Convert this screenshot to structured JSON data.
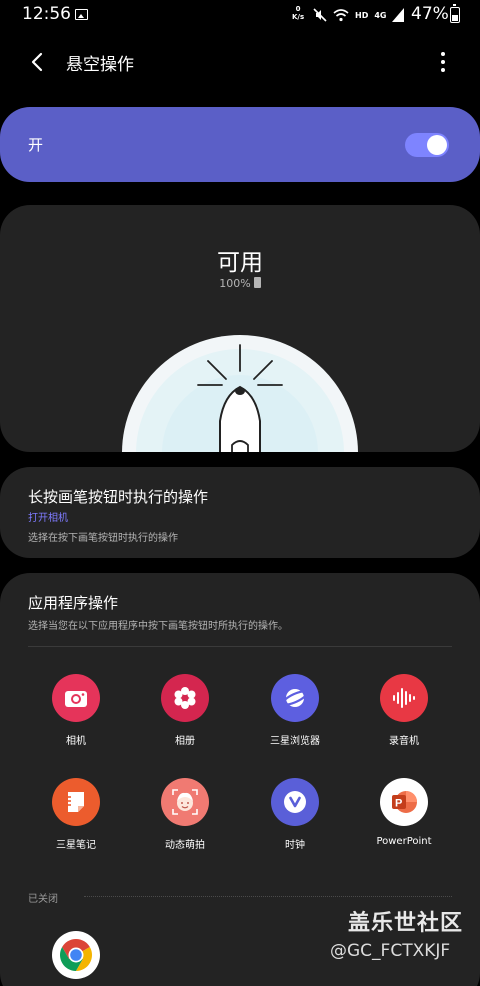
{
  "status_bar": {
    "time": "12:56",
    "net_speed_value": "0",
    "net_speed_unit": "K/s",
    "hd_label": "HD",
    "network_label": "4G",
    "battery_percent": "47%",
    "icons": [
      "image-icon",
      "mute-icon",
      "wifi-icon",
      "signal-icon",
      "battery-icon"
    ]
  },
  "app_bar": {
    "title": "悬空操作",
    "back_icon": "back-arrow-icon",
    "more_icon": "more-vert-icon"
  },
  "master_switch": {
    "label": "开",
    "state": true,
    "accent_color": "#5b5fc7"
  },
  "pen": {
    "status": "可用",
    "battery": "100%"
  },
  "long_press": {
    "title": "长按画笔按钮时执行的操作",
    "value": "打开相机",
    "description": "选择在按下画笔按钮时执行的操作"
  },
  "app_actions": {
    "title": "应用程序操作",
    "description": "选择当您在以下应用程序中按下画笔按钮时所执行的操作。",
    "apps": [
      {
        "label": "相机",
        "icon": "camera-icon",
        "color": "#e5345a"
      },
      {
        "label": "相册",
        "icon": "gallery-flower-icon",
        "color": "#d4264f"
      },
      {
        "label": "三星浏览器",
        "icon": "browser-planet-icon",
        "color": "#5d5fe0"
      },
      {
        "label": "录音机",
        "icon": "voice-recorder-icon",
        "color": "#e83844"
      },
      {
        "label": "三星笔记",
        "icon": "notes-icon",
        "color": "#ec5c2d"
      },
      {
        "label": "动态萌拍",
        "icon": "ar-emoji-icon",
        "color": "#f07a72"
      },
      {
        "label": "时钟",
        "icon": "clock-icon",
        "color": "#5a5fd8"
      },
      {
        "label": "PowerPoint",
        "icon": "powerpoint-icon",
        "color": "#c9402b"
      }
    ],
    "closed_label": "已关闭",
    "closed_apps": [
      {
        "label": "Chrome",
        "icon": "chrome-icon"
      }
    ]
  },
  "watermark": {
    "title": "盖乐世社区",
    "handle": "@GC_FCTXKJF"
  }
}
